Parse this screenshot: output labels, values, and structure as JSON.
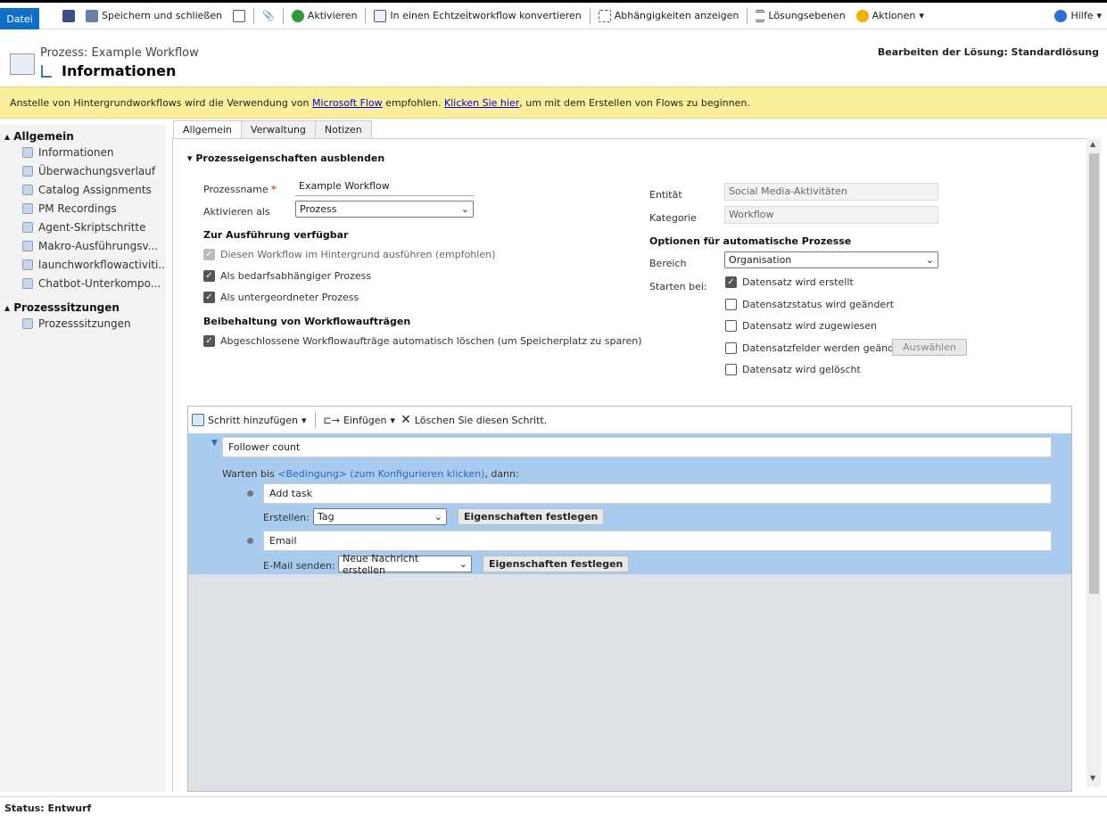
{
  "toolbar": {
    "datei": "Datei",
    "save_close": "Speichern und schließen",
    "activate": "Aktivieren",
    "convert": "In einen Echtzeitworkflow konvertieren",
    "dependencies": "Abhängigkeiten anzeigen",
    "layers": "Lösungsebenen",
    "actions": "Aktionen",
    "help": "Hilfe"
  },
  "header": {
    "subtitle": "Prozess: Example Workflow",
    "title": "Informationen",
    "solution": "Bearbeiten der Lösung: Standardlösung"
  },
  "banner": {
    "pre": "Anstelle von Hintergrundworkflows wird die Verwendung von ",
    "link1": "Microsoft Flow",
    "mid": " empfohlen. ",
    "link2": "Klicken Sie hier",
    "post": ", um mit dem Erstellen von Flows zu beginnen."
  },
  "sidebar": {
    "section1": "Allgemein",
    "items": [
      "Informationen",
      "Überwachungsverlauf",
      "Catalog Assignments",
      "PM Recordings",
      "Agent-Skriptschritte",
      "Makro-Ausführungsv...",
      "launchworkflowactiviti...",
      "Chatbot-Unterkompo..."
    ],
    "section2": "Prozesssitzungen",
    "items2": [
      "Prozesssitzungen"
    ]
  },
  "tabs": [
    "Allgemein",
    "Verwaltung",
    "Notizen"
  ],
  "form": {
    "section": "Prozesseigenschaften ausblenden",
    "name_label": "Prozessname",
    "name_value": "Example Workflow",
    "activate_label": "Aktivieren als",
    "activate_value": "Prozess",
    "avail_heading": "Zur Ausführung verfügbar",
    "cb_background": "Diesen Workflow im Hintergrund ausführen (empfohlen)",
    "cb_ondemand": "Als bedarfsabhängiger Prozess",
    "cb_child": "Als untergeordneter Prozess",
    "retain_heading": "Beibehaltung von Workflowaufträgen",
    "cb_delete": "Abgeschlossene Workflowaufträge automatisch löschen (um Speicherplatz zu sparen)",
    "entity_label": "Entität",
    "entity_value": "Social Media-Aktivitäten",
    "category_label": "Kategorie",
    "category_value": "Workflow",
    "auto_heading": "Optionen für automatische Prozesse",
    "scope_label": "Bereich",
    "scope_value": "Organisation",
    "start_label": "Starten bei:",
    "start_created": "Datensatz wird erstellt",
    "start_status": "Datensatzstatus wird geändert",
    "start_assigned": "Datensatz wird zugewiesen",
    "start_fields": "Datensatzfelder werden geändert",
    "select_btn": "Auswählen",
    "start_deleted": "Datensatz wird gelöscht"
  },
  "designer": {
    "add_step": "Schritt hinzufügen",
    "insert": "Einfügen",
    "delete": "Löschen Sie diesen Schritt.",
    "step_name": "Follower count",
    "wait_pre": "Warten bis ",
    "condition": "<Bedingung> (zum Konfigurieren klicken)",
    "wait_post": ", dann:",
    "action1": "Add task",
    "action1_label": "Erstellen:",
    "action1_value": "Tag",
    "props": "Eigenschaften festlegen",
    "action2": "Email",
    "action2_label": "E-Mail senden:",
    "action2_value": "Neue Nachricht erstellen"
  },
  "status": "Status: Entwurf"
}
